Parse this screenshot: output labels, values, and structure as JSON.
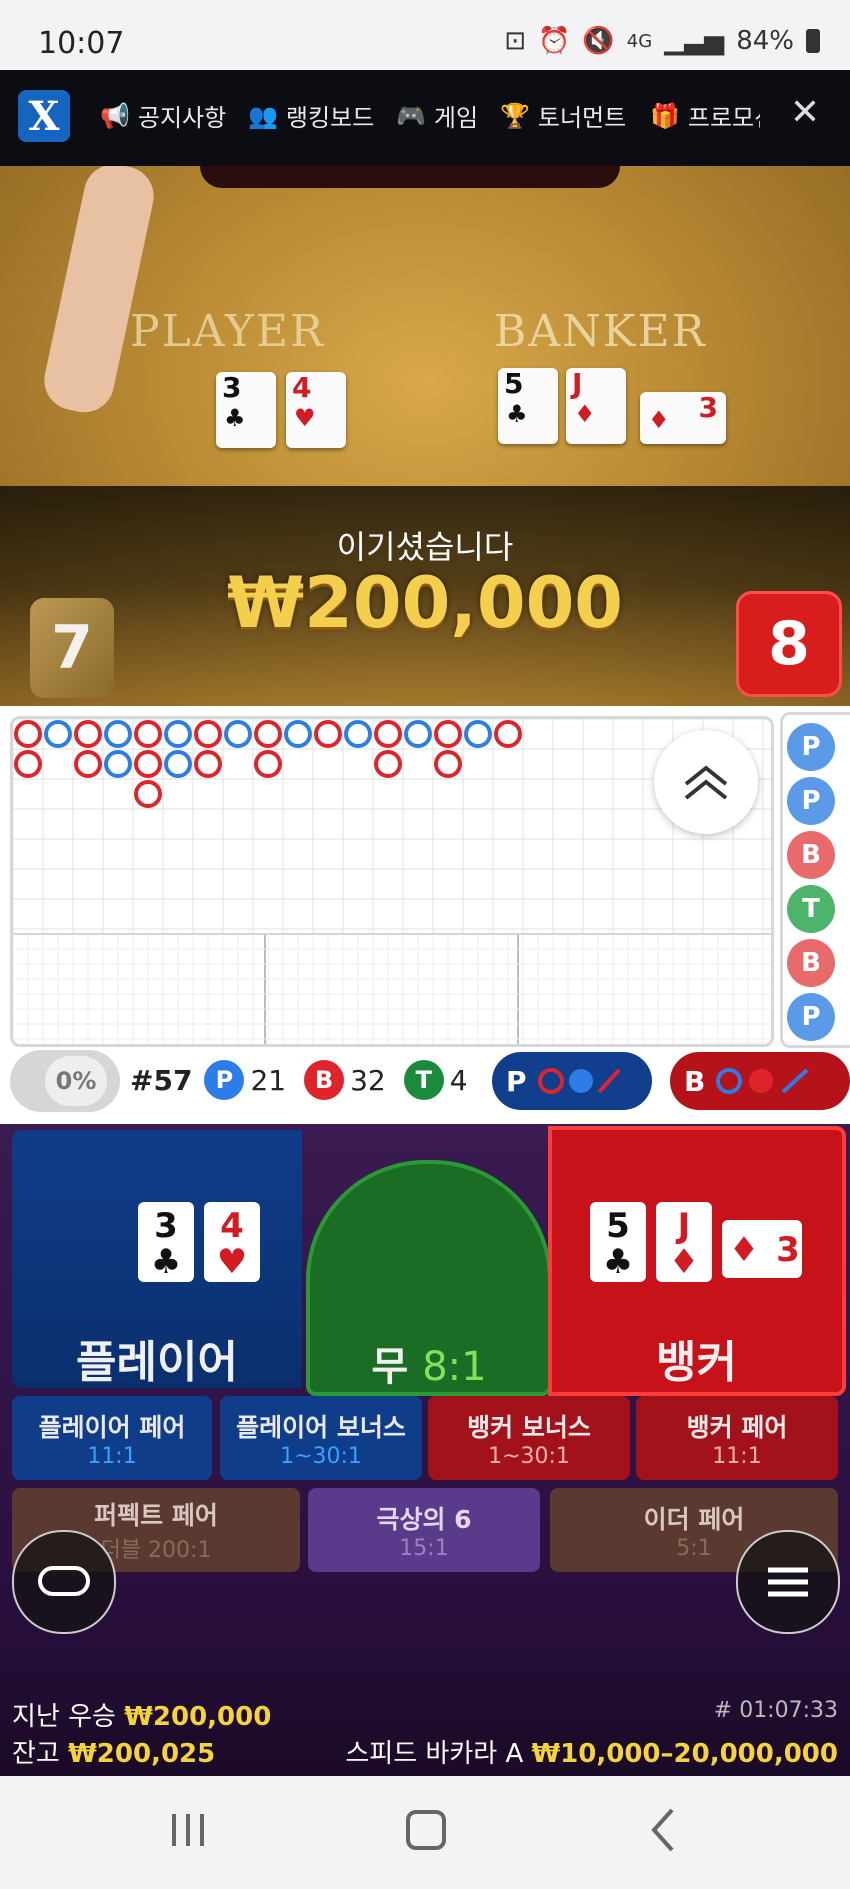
{
  "status_bar": {
    "time": "10:07",
    "battery": "84%",
    "network": "4G"
  },
  "nav": {
    "logo": "X",
    "items": [
      {
        "label": "공지사항",
        "icon": "megaphone-icon"
      },
      {
        "label": "랭킹보드",
        "icon": "users-icon"
      },
      {
        "label": "게임",
        "icon": "gamepad-icon"
      },
      {
        "label": "토너먼트",
        "icon": "trophy-icon"
      },
      {
        "label": "프로모션",
        "icon": "gift-icon"
      }
    ],
    "close_icon": "close-icon"
  },
  "video": {
    "player_label": "PLAYER",
    "banker_label": "BANKER",
    "player_cards": [
      {
        "rank": "3",
        "suit": "♣",
        "color": "black"
      },
      {
        "rank": "4",
        "suit": "♥",
        "color": "red"
      }
    ],
    "banker_cards": [
      {
        "rank": "5",
        "suit": "♣",
        "color": "black"
      },
      {
        "rank": "J",
        "suit": "♦",
        "color": "red"
      },
      {
        "rank": "3",
        "suit": "♦",
        "color": "red"
      }
    ],
    "win_text": "이기셨습니다",
    "win_amount": "₩200,000",
    "player_score": "7",
    "banker_score": "8"
  },
  "scoreboard": {
    "toggle_percent": "0%",
    "round": "#57",
    "player_count": "21",
    "banker_count": "32",
    "tie_count": "4",
    "p_label": "P",
    "b_label": "B",
    "t_label": "T",
    "side_results": [
      "P",
      "P",
      "B",
      "T",
      "B",
      "P"
    ],
    "big_road": [
      [
        "B",
        "B"
      ],
      [
        "P"
      ],
      [
        "B",
        "B"
      ],
      [
        "P",
        "P"
      ],
      [
        "B",
        "B",
        "B"
      ],
      [
        "P",
        "P"
      ],
      [
        "B",
        "B"
      ],
      [
        "P"
      ],
      [
        "B",
        "B"
      ],
      [
        "P"
      ],
      [
        "B"
      ],
      [
        "P"
      ],
      [
        "B",
        "B"
      ],
      [
        "P"
      ],
      [
        "B",
        "B"
      ],
      [
        "P"
      ],
      [
        "B"
      ]
    ]
  },
  "colors": {
    "player": "#2d7de8",
    "banker": "#e0242c",
    "tie": "#1b8a3a",
    "gold": "#f5d33b"
  },
  "bets": {
    "player": {
      "label": "플레이어",
      "cards": [
        {
          "rank": "3",
          "suit": "♣",
          "color": "black"
        },
        {
          "rank": "4",
          "suit": "♥",
          "color": "red"
        }
      ]
    },
    "tie": {
      "label": "무",
      "odds": "8:1"
    },
    "banker": {
      "label": "뱅커",
      "cards": [
        {
          "rank": "5",
          "suit": "♣",
          "color": "black"
        },
        {
          "rank": "J",
          "suit": "♦",
          "color": "red"
        },
        {
          "rank": "3",
          "suit": "♦",
          "color": "red"
        }
      ]
    },
    "side": [
      {
        "label": "플레이어 페어",
        "odds": "11:1"
      },
      {
        "label": "플레이어 보너스",
        "odds": "1~30:1"
      },
      {
        "label": "뱅커 보너스",
        "odds": "1~30:1"
      },
      {
        "label": "뱅커 페어",
        "odds": "11:1"
      }
    ],
    "extra": [
      {
        "label": "퍼펙트 페어",
        "odds": "더블 200:1"
      },
      {
        "label": "극상의 6",
        "odds": "15:1"
      },
      {
        "label": "이더 페어",
        "odds": "5:1"
      }
    ]
  },
  "footer": {
    "last_win_label": "지난 우승",
    "last_win_value": "₩200,000",
    "balance_label": "잔고",
    "balance_value": "₩200,025",
    "game_id": "# 01:07:33",
    "table_name": "스피드 바카라 A",
    "limits": "₩10,000–20,000,000"
  }
}
